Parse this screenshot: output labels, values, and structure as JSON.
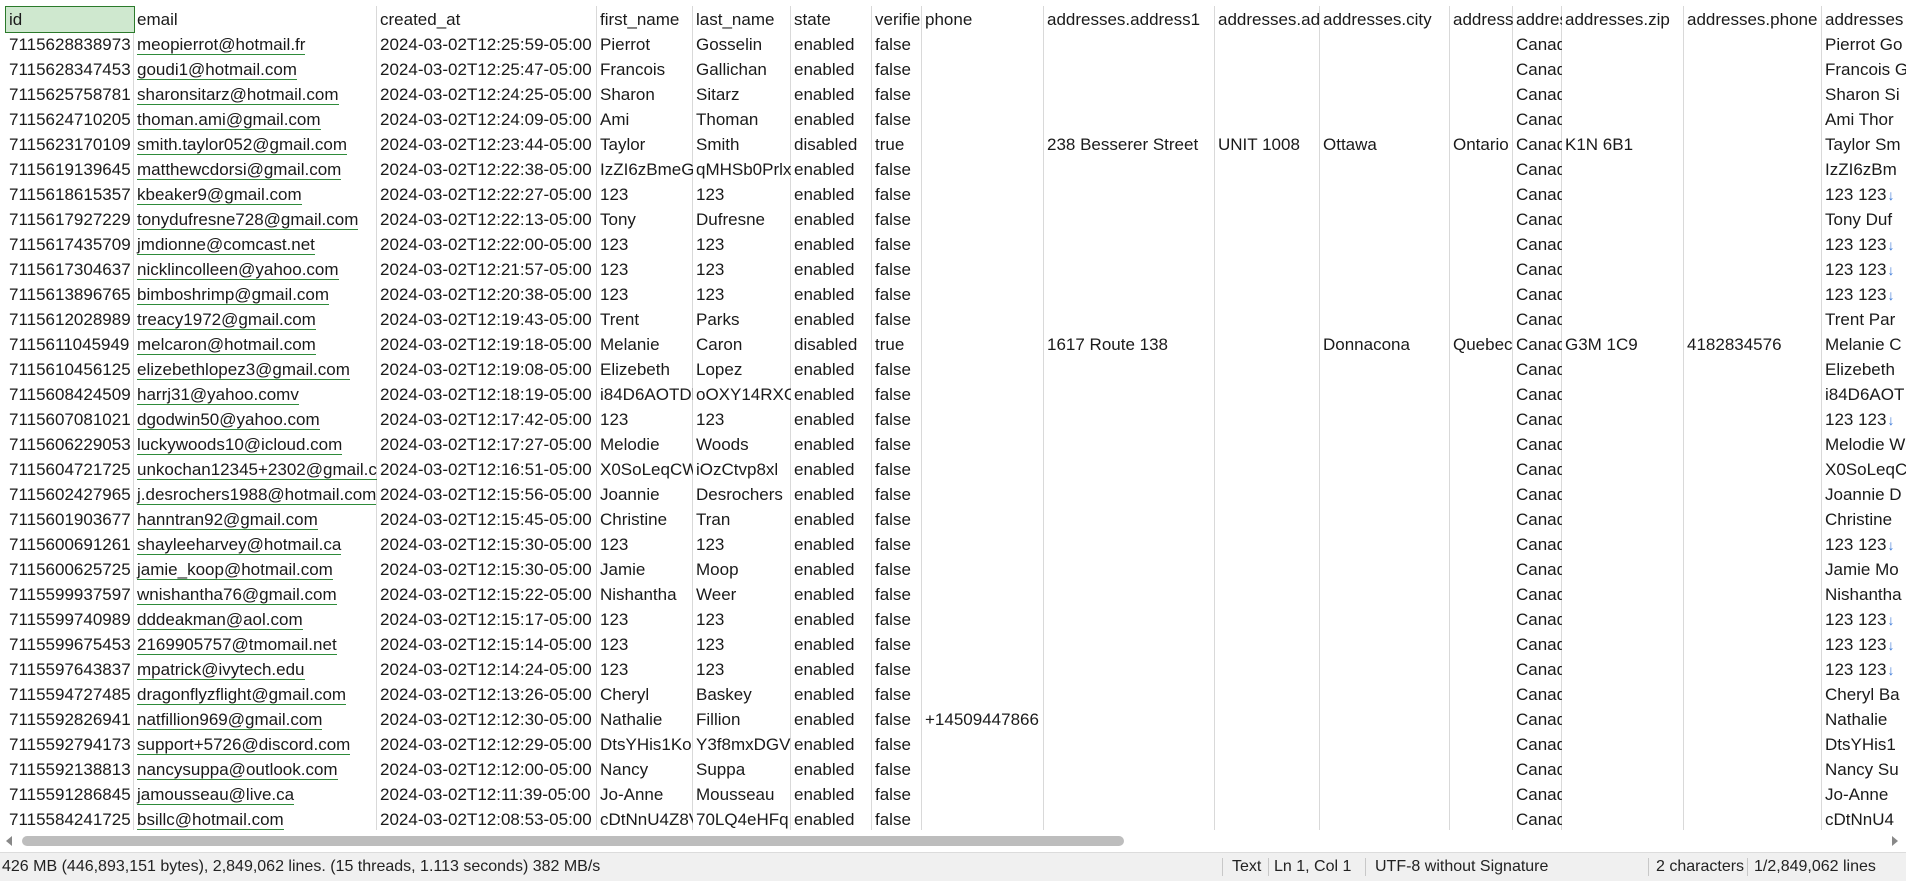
{
  "columns": [
    {
      "key": "id",
      "label": "id",
      "w": 128
    },
    {
      "key": "email",
      "label": "email",
      "w": 243
    },
    {
      "key": "created_at",
      "label": "created_at",
      "w": 220
    },
    {
      "key": "first_name",
      "label": "first_name",
      "w": 96
    },
    {
      "key": "last_name",
      "label": "last_name",
      "w": 98
    },
    {
      "key": "state",
      "label": "state",
      "w": 81
    },
    {
      "key": "verified",
      "label": "verifie",
      "w": 50
    },
    {
      "key": "phone",
      "label": "phone",
      "w": 122
    },
    {
      "key": "address1",
      "label": "addresses.address1",
      "w": 171
    },
    {
      "key": "address2",
      "label": "addresses.ad",
      "w": 105
    },
    {
      "key": "city",
      "label": "addresses.city",
      "w": 130
    },
    {
      "key": "province",
      "label": "addresse",
      "w": 63
    },
    {
      "key": "country",
      "label": "addres",
      "w": 49
    },
    {
      "key": "zip",
      "label": "addresses.zip",
      "w": 122
    },
    {
      "key": "aphone",
      "label": "addresses.phone",
      "w": 138
    },
    {
      "key": "name",
      "label": "addresses",
      "w": 90
    }
  ],
  "rows": [
    [
      "7115628838973",
      "meopierrot@hotmail.fr",
      "2024-03-02T12:25:59-05:00",
      "Pierrot",
      "Gosselin",
      "enabled",
      "false",
      "",
      "",
      "",
      "",
      "",
      "Canad",
      "",
      "",
      "Pierrot Go"
    ],
    [
      "7115628347453",
      "goudi1@hotmail.com",
      "2024-03-02T12:25:47-05:00",
      "Francois",
      "Gallichan",
      "enabled",
      "false",
      "",
      "",
      "",
      "",
      "",
      "Canad",
      "",
      "",
      "Francois G"
    ],
    [
      "7115625758781",
      "sharonsitarz@hotmail.com",
      "2024-03-02T12:24:25-05:00",
      "Sharon",
      "Sitarz",
      "enabled",
      "false",
      "",
      "",
      "",
      "",
      "",
      "Canad",
      "",
      "",
      "Sharon Si"
    ],
    [
      "7115624710205",
      "thoman.ami@gmail.com",
      "2024-03-02T12:24:09-05:00",
      "Ami",
      "Thoman",
      "enabled",
      "false",
      "",
      "",
      "",
      "",
      "",
      "Canad",
      "",
      "",
      "Ami Thor"
    ],
    [
      "7115623170109",
      "smith.taylor052@gmail.com",
      "2024-03-02T12:23:44-05:00",
      "Taylor",
      "Smith",
      "disabled",
      "true",
      "",
      "238 Besserer Street",
      "UNIT 1008",
      "Ottawa",
      "Ontario",
      "Canad",
      "K1N 6B1",
      "",
      "Taylor Sm"
    ],
    [
      "7115619139645",
      "matthewcdorsi@gmail.com",
      "2024-03-02T12:22:38-05:00",
      "IzZI6zBmeG",
      "qMHSb0Prlx",
      "enabled",
      "false",
      "",
      "",
      "",
      "",
      "",
      "Canad",
      "",
      "",
      "IzZI6zBm"
    ],
    [
      "7115618615357",
      "kbeaker9@gmail.com",
      "2024-03-02T12:22:27-05:00",
      "123",
      "123",
      "enabled",
      "false",
      "",
      "",
      "",
      "",
      "",
      "Canad",
      "",
      "",
      "123 123↓"
    ],
    [
      "7115617927229",
      "tonydufresne728@gmail.com",
      "2024-03-02T12:22:13-05:00",
      "Tony",
      "Dufresne",
      "enabled",
      "false",
      "",
      "",
      "",
      "",
      "",
      "Canad",
      "",
      "",
      "Tony Duf"
    ],
    [
      "7115617435709",
      "jmdionne@comcast.net",
      "2024-03-02T12:22:00-05:00",
      "123",
      "123",
      "enabled",
      "false",
      "",
      "",
      "",
      "",
      "",
      "Canad",
      "",
      "",
      "123 123↓"
    ],
    [
      "7115617304637",
      "nicklincolleen@yahoo.com",
      "2024-03-02T12:21:57-05:00",
      "123",
      "123",
      "enabled",
      "false",
      "",
      "",
      "",
      "",
      "",
      "Canad",
      "",
      "",
      "123 123↓"
    ],
    [
      "7115613896765",
      "bimboshrimp@gmail.com",
      "2024-03-02T12:20:38-05:00",
      "123",
      "123",
      "enabled",
      "false",
      "",
      "",
      "",
      "",
      "",
      "Canad",
      "",
      "",
      "123 123↓"
    ],
    [
      "7115612028989",
      "treacy1972@gmail.com",
      "2024-03-02T12:19:43-05:00",
      "Trent",
      "Parks",
      "enabled",
      "false",
      "",
      "",
      "",
      "",
      "",
      "Canad",
      "",
      "",
      "Trent Par"
    ],
    [
      "7115611045949",
      "melcaron@hotmail.com",
      "2024-03-02T12:19:18-05:00",
      "Melanie",
      "Caron",
      "disabled",
      "true",
      "",
      "1617 Route 138",
      "",
      "Donnacona",
      "Quebec",
      "Canad",
      "G3M 1C9",
      "4182834576",
      "Melanie C"
    ],
    [
      "7115610456125",
      "elizebethlopez3@gmail.com",
      "2024-03-02T12:19:08-05:00",
      "Elizebeth",
      "Lopez",
      "enabled",
      "false",
      "",
      "",
      "",
      "",
      "",
      "Canad",
      "",
      "",
      "Elizebeth"
    ],
    [
      "7115608424509",
      "harrj31@yahoo.comv",
      "2024-03-02T12:18:19-05:00",
      "i84D6AOTDk",
      "oOXY14RXC",
      "enabled",
      "false",
      "",
      "",
      "",
      "",
      "",
      "Canad",
      "",
      "",
      "i84D6AOT"
    ],
    [
      "7115607081021",
      "dgodwin50@yahoo.com",
      "2024-03-02T12:17:42-05:00",
      "123",
      "123",
      "enabled",
      "false",
      "",
      "",
      "",
      "",
      "",
      "Canad",
      "",
      "",
      "123 123↓"
    ],
    [
      "7115606229053",
      "luckywoods10@icloud.com",
      "2024-03-02T12:17:27-05:00",
      "Melodie",
      "Woods",
      "enabled",
      "false",
      "",
      "",
      "",
      "",
      "",
      "Canad",
      "",
      "",
      "Melodie W"
    ],
    [
      "7115604721725",
      "unkochan12345+2302@gmail.c",
      "2024-03-02T12:16:51-05:00",
      "X0SoLeqCWi",
      "iOzCtvp8xl",
      "enabled",
      "false",
      "",
      "",
      "",
      "",
      "",
      "Canad",
      "",
      "",
      "X0SoLeqC"
    ],
    [
      "7115602427965",
      "j.desrochers1988@hotmail.com",
      "2024-03-02T12:15:56-05:00",
      "Joannie",
      "Desrochers",
      "enabled",
      "false",
      "",
      "",
      "",
      "",
      "",
      "Canad",
      "",
      "",
      "Joannie D"
    ],
    [
      "7115601903677",
      "hanntran92@gmail.com",
      "2024-03-02T12:15:45-05:00",
      "Christine",
      "Tran",
      "enabled",
      "false",
      "",
      "",
      "",
      "",
      "",
      "Canad",
      "",
      "",
      "Christine"
    ],
    [
      "7115600691261",
      "shayleeharvey@hotmail.ca",
      "2024-03-02T12:15:30-05:00",
      "123",
      "123",
      "enabled",
      "false",
      "",
      "",
      "",
      "",
      "",
      "Canad",
      "",
      "",
      "123 123↓"
    ],
    [
      "7115600625725",
      "jamie_koop@hotmail.com",
      "2024-03-02T12:15:30-05:00",
      "Jamie",
      "Moop",
      "enabled",
      "false",
      "",
      "",
      "",
      "",
      "",
      "Canad",
      "",
      "",
      "Jamie Mo"
    ],
    [
      "7115599937597",
      "wnishantha76@gmail.com",
      "2024-03-02T12:15:22-05:00",
      "Nishantha",
      "Weer",
      "enabled",
      "false",
      "",
      "",
      "",
      "",
      "",
      "Canad",
      "",
      "",
      "Nishantha"
    ],
    [
      "7115599740989",
      "dddeakman@aol.com",
      "2024-03-02T12:15:17-05:00",
      "123",
      "123",
      "enabled",
      "false",
      "",
      "",
      "",
      "",
      "",
      "Canad",
      "",
      "",
      "123 123↓"
    ],
    [
      "7115599675453",
      "2169905757@tmomail.net",
      "2024-03-02T12:15:14-05:00",
      "123",
      "123",
      "enabled",
      "false",
      "",
      "",
      "",
      "",
      "",
      "Canad",
      "",
      "",
      "123 123↓"
    ],
    [
      "7115597643837",
      "mpatrick@ivytech.edu",
      "2024-03-02T12:14:24-05:00",
      "123",
      "123",
      "enabled",
      "false",
      "",
      "",
      "",
      "",
      "",
      "Canad",
      "",
      "",
      "123 123↓"
    ],
    [
      "7115594727485",
      "dragonflyzflight@gmail.com",
      "2024-03-02T12:13:26-05:00",
      "Cheryl",
      "Baskey",
      "enabled",
      "false",
      "",
      "",
      "",
      "",
      "",
      "Canad",
      "",
      "",
      "Cheryl Ba"
    ],
    [
      "7115592826941",
      "natfillion969@gmail.com",
      "2024-03-02T12:12:30-05:00",
      "Nathalie",
      "Fillion",
      "enabled",
      "false",
      "+14509447866",
      "",
      "",
      "",
      "",
      "Canad",
      "",
      "",
      "Nathalie"
    ],
    [
      "7115592794173",
      "support+5726@discord.com",
      "2024-03-02T12:12:29-05:00",
      "DtsYHis1Ko",
      "Y3f8mxDGV",
      "enabled",
      "false",
      "",
      "",
      "",
      "",
      "",
      "Canad",
      "",
      "",
      "DtsYHis1"
    ],
    [
      "7115592138813",
      "nancysuppa@outlook.com",
      "2024-03-02T12:12:00-05:00",
      "Nancy",
      "Suppa",
      "enabled",
      "false",
      "",
      "",
      "",
      "",
      "",
      "Canad",
      "",
      "",
      "Nancy Su"
    ],
    [
      "7115591286845",
      "jamousseau@live.ca",
      "2024-03-02T12:11:39-05:00",
      "Jo-Anne",
      "Mousseau",
      "enabled",
      "false",
      "",
      "",
      "",
      "",
      "",
      "Canad",
      "",
      "",
      "Jo-Anne"
    ],
    [
      "7115584241725",
      "bsillc@hotmail.com",
      "2024-03-02T12:08:53-05:00",
      "cDtNnU4Z8V",
      "70LQ4eHFq",
      "enabled",
      "false",
      "",
      "",
      "",
      "",
      "",
      "Canad",
      "",
      "",
      "cDtNnU4"
    ]
  ],
  "status": {
    "file_info": "426 MB (446,893,151 bytes), 2,849,062 lines. (15 threads, 1.113 seconds) 382 MB/s",
    "mode": "Text",
    "position": "Ln 1, Col 1",
    "encoding": "UTF-8 without Signature",
    "selection": "2 characters",
    "line_info": "1/2,849,062 lines"
  }
}
